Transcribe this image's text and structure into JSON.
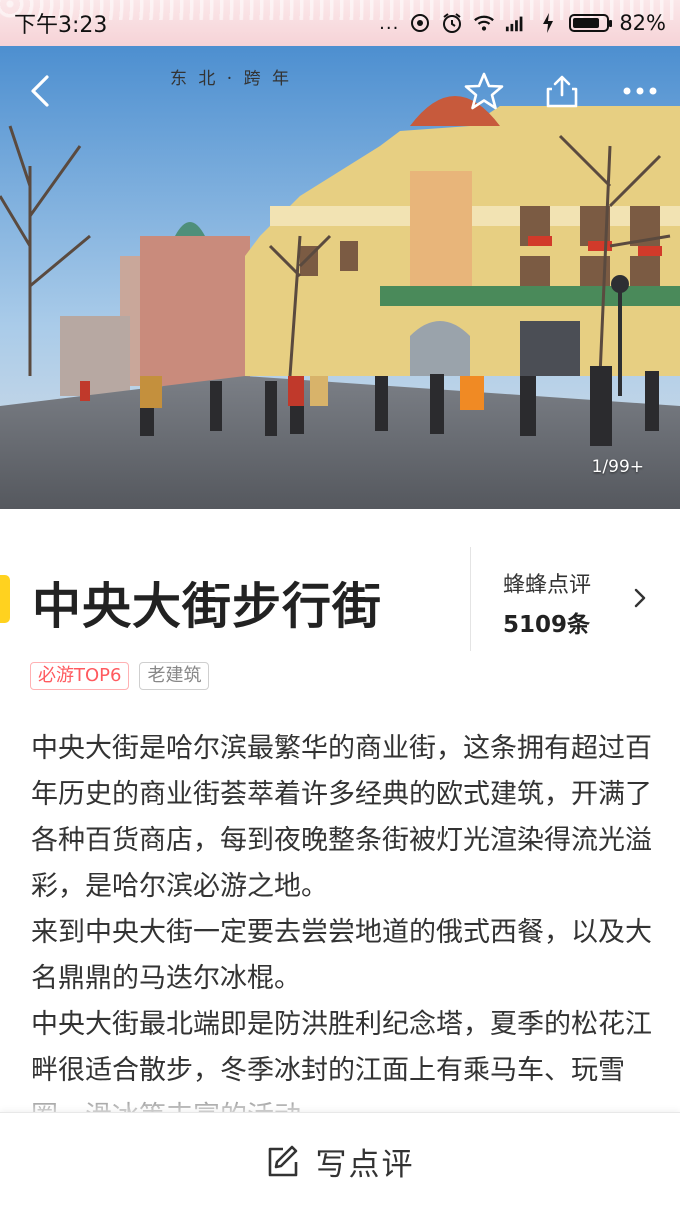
{
  "status_bar": {
    "time": "下午3:23",
    "dots": "...",
    "battery_percent": "82%",
    "battery_level": 0.82
  },
  "hero": {
    "photo_caption": "东 北 · 跨 年",
    "counter": "1/99+",
    "icons": [
      "back-arrow-icon",
      "star-icon",
      "share-icon",
      "more-icon"
    ]
  },
  "attraction": {
    "title": "中央大街步行街",
    "review_label": "蜂蜂点评",
    "review_count": "5109条",
    "tags": [
      {
        "label": "必游TOP6",
        "style": "hot"
      },
      {
        "label": "老建筑",
        "style": "normal"
      }
    ],
    "description": [
      "中央大街是哈尔滨最繁华的商业街，这条拥有超过百年历史的商业街荟萃着许多经典的欧式建筑，开满了各种百货商店，每到夜晚整条街被灯光渲染得流光溢彩，是哈尔滨必游之地。",
      "来到中央大街一定要去尝尝地道的俄式西餐，以及大名鼎鼎的马迭尔冰棍。",
      "中央大街最北端即是防洪胜利纪念塔，夏季的松花江畔很适合散步，冬季冰封的江面上有乘马车、玩雪圈、滑冰等丰富的活动。"
    ]
  },
  "bottom_bar": {
    "write_review_label": "写点评"
  },
  "colors": {
    "accent": "#ffd21f",
    "hot_tag": "#ff5a5f",
    "status_bar_bg": "#f6d3d7"
  }
}
